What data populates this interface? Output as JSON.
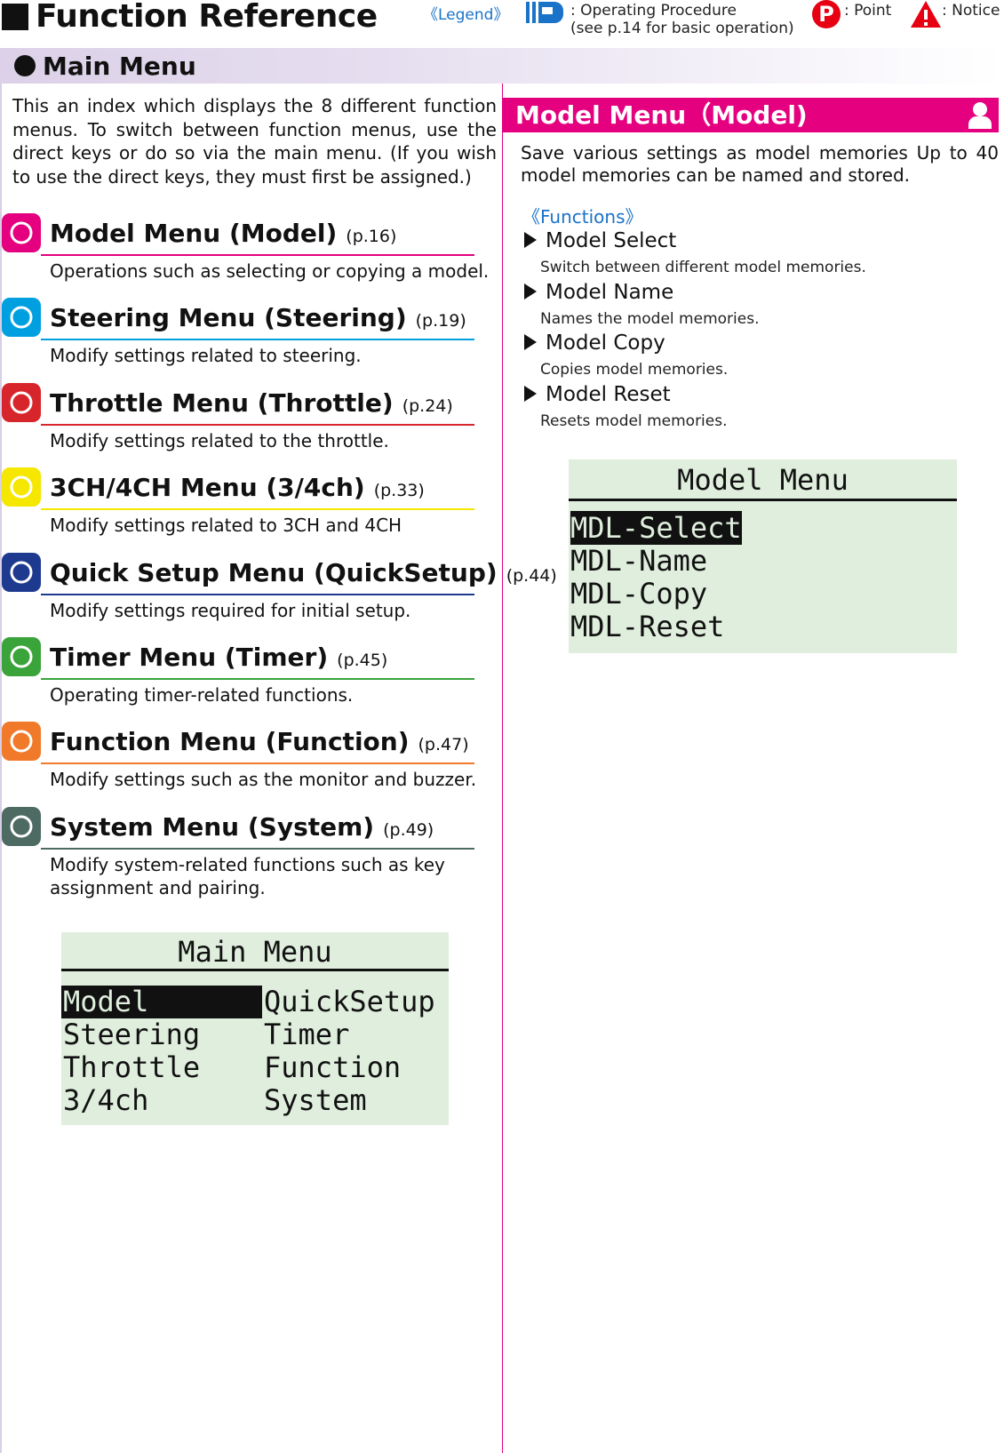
{
  "header": {
    "title": "Function Reference",
    "legend_label": "《Legend》",
    "legend_proc": ": Operating Procedure",
    "legend_proc_note": "(see p.14 for basic operation)",
    "legend_point": ": Point",
    "legend_notice": ": Notice",
    "icons": [
      "operating-procedure-icon",
      "point-icon",
      "notice-icon"
    ]
  },
  "section": {
    "title": "Main Menu",
    "intro": "This an index which displays the 8 different function menus. To switch between function menus, use the direct keys or do so via the main menu. (If you wish to use the direct keys, they must first be assigned.)"
  },
  "menus": [
    {
      "title": "Model Menu (Model)",
      "page": "(p.16)",
      "desc": "Operations such as selecting or copying a model.",
      "color": "#e4007f",
      "icon": "person-icon"
    },
    {
      "title": "Steering Menu (Steering)",
      "page": "(p.19)",
      "desc": "Modify settings related to steering.",
      "color": "#00a0e0",
      "icon": "steering-wheel-icon"
    },
    {
      "title": "Throttle Menu (Throttle)",
      "page": "(p.24)",
      "desc": "Modify settings related to the throttle.",
      "color": "#d7262b",
      "icon": "throttle-icon"
    },
    {
      "title": "3CH/4CH Menu (3/4ch)",
      "page": "(p.33)",
      "desc": "Modify settings related to 3CH and 4CH",
      "color": "#f5e700",
      "icon": "switch-icon"
    },
    {
      "title": "Quick Setup Menu (QuickSetup)",
      "page": "(p.44)",
      "desc": "Modify settings required for initial setup.",
      "color": "#1d3a8f",
      "icon": "wrench-icon"
    },
    {
      "title": "Timer Menu (Timer)",
      "page": "(p.45)",
      "desc": "Operating timer-related functions.",
      "color": "#3aa33a",
      "icon": "timer-icon"
    },
    {
      "title": "Function Menu (Function)",
      "page": "(p.47)",
      "desc": "Modify settings such as the monitor and buzzer.",
      "color": "#f07a2a",
      "icon": "function-icon"
    },
    {
      "title": "System Menu (System)",
      "page": "(p.49)",
      "desc": "Modify system-related functions such as key assignment and pairing.",
      "color": "#4d6a63",
      "icon": "list-icon"
    }
  ],
  "main_lcd": {
    "title": "Main Menu",
    "left": [
      "Model",
      "Steering",
      "Throttle",
      "3/4ch"
    ],
    "right": [
      "QuickSetup",
      "Timer",
      "Function",
      "System"
    ]
  },
  "model": {
    "title": "Model Menu（Model)",
    "intro": "Save various settings as model memories Up to 40 model memories can be named and stored.",
    "functions_label": "《Functions》",
    "functions": [
      {
        "name": "Model Select",
        "desc": "Switch between different model memories."
      },
      {
        "name": "Model Name",
        "desc": "Names the model memories."
      },
      {
        "name": "Model Copy",
        "desc": "Copies model memories."
      },
      {
        "name": "Model Reset",
        "desc": "Resets model memories."
      }
    ],
    "lcd": {
      "title": "Model Menu",
      "items": [
        "MDL-Select",
        "MDL-Name",
        "MDL-Copy",
        "MDL-Reset"
      ]
    }
  }
}
